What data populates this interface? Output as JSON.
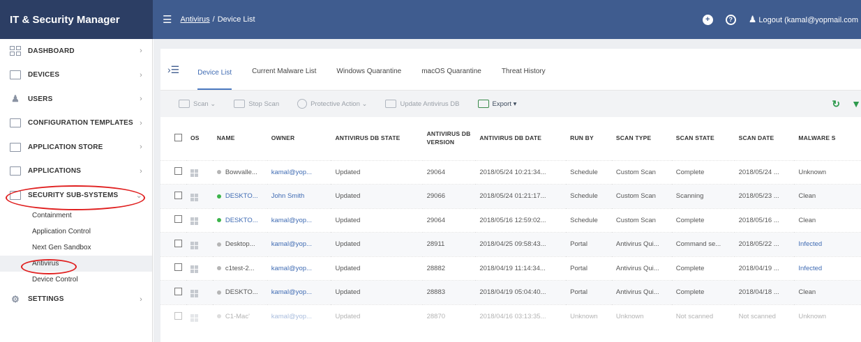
{
  "app": {
    "title": "IT & Security Manager"
  },
  "header": {
    "breadcrumb_link": "Antivirus",
    "breadcrumb_sep": "/",
    "breadcrumb_current": "Device List",
    "logout_label": "Logout (kamal@yopmail.com"
  },
  "sidebar": {
    "items": [
      {
        "label": "DASHBOARD",
        "icon": "dashboard-icon"
      },
      {
        "label": "DEVICES",
        "icon": "devices-icon"
      },
      {
        "label": "USERS",
        "icon": "user-icon"
      },
      {
        "label": "CONFIGURATION TEMPLATES",
        "icon": "templates-icon"
      },
      {
        "label": "APPLICATION STORE",
        "icon": "store-icon"
      },
      {
        "label": "APPLICATIONS",
        "icon": "applications-icon"
      },
      {
        "label": "SECURITY SUB-SYSTEMS",
        "icon": "security-icon"
      },
      {
        "label": "SETTINGS",
        "icon": "gear-icon"
      }
    ],
    "sub_items": [
      "Containment",
      "Application Control",
      "Next Gen Sandbox",
      "Antivirus",
      "Device Control"
    ]
  },
  "tabs": [
    "Device List",
    "Current Malware List",
    "Windows Quarantine",
    "macOS Quarantine",
    "Threat History"
  ],
  "toolbar": {
    "scan": "Scan",
    "stop_scan": "Stop Scan",
    "protective_action": "Protective Action",
    "update_db": "Update Antivirus DB",
    "export": "Export"
  },
  "table": {
    "headers": [
      "OS",
      "NAME",
      "OWNER",
      "ANTIVIRUS DB STATE",
      "ANTIVIRUS DB VERSION",
      "ANTIVIRUS DB DATE",
      "RUN BY",
      "SCAN TYPE",
      "SCAN STATE",
      "SCAN DATE",
      "MALWARE S"
    ],
    "rows": [
      {
        "status": "grey",
        "name": "Bowvalle...",
        "owner": "kamal@yop...",
        "db_state": "Updated",
        "db_version": "29064",
        "db_date": "2018/05/24 10:21:34...",
        "run_by": "Schedule",
        "scan_type": "Custom Scan",
        "scan_state": "Complete",
        "scan_date": "2018/05/24 ...",
        "malware": "Unknown"
      },
      {
        "status": "green",
        "name": "DESKTO...",
        "owner": "John Smith",
        "db_state": "Updated",
        "db_version": "29066",
        "db_date": "2018/05/24 01:21:17...",
        "run_by": "Schedule",
        "scan_type": "Custom Scan",
        "scan_state": "Scanning",
        "scan_date": "2018/05/23 ...",
        "malware": "Clean"
      },
      {
        "status": "green",
        "name": "DESKTO...",
        "owner": "kamal@yop...",
        "db_state": "Updated",
        "db_version": "29064",
        "db_date": "2018/05/16 12:59:02...",
        "run_by": "Schedule",
        "scan_type": "Custom Scan",
        "scan_state": "Complete",
        "scan_date": "2018/05/16 ...",
        "malware": "Clean"
      },
      {
        "status": "grey",
        "name": "Desktop...",
        "owner": "kamal@yop...",
        "db_state": "Updated",
        "db_version": "28911",
        "db_date": "2018/04/25 09:58:43...",
        "run_by": "Portal",
        "scan_type": "Antivirus Qui...",
        "scan_state": "Command se...",
        "scan_date": "2018/05/22 ...",
        "malware": "Infected"
      },
      {
        "status": "grey",
        "name": "c1test-2...",
        "owner": "kamal@yop...",
        "db_state": "Updated",
        "db_version": "28882",
        "db_date": "2018/04/19 11:14:34...",
        "run_by": "Portal",
        "scan_type": "Antivirus Qui...",
        "scan_state": "Complete",
        "scan_date": "2018/04/19 ...",
        "malware": "Infected"
      },
      {
        "status": "grey",
        "name": "DESKTO...",
        "owner": "kamal@yop...",
        "db_state": "Updated",
        "db_version": "28883",
        "db_date": "2018/04/19 05:04:40...",
        "run_by": "Portal",
        "scan_type": "Antivirus Qui...",
        "scan_state": "Complete",
        "scan_date": "2018/04/18 ...",
        "malware": "Clean"
      },
      {
        "status": "grey",
        "name": "C1-Mac'",
        "owner": "kamal@yop...",
        "db_state": "Updated",
        "db_version": "28870",
        "db_date": "2018/04/16 03:13:35...",
        "run_by": "Unknown",
        "scan_type": "Unknown",
        "scan_state": "Not scanned",
        "scan_date": "Not scanned",
        "malware": "Unknown"
      }
    ]
  },
  "colors": {
    "brand": "#2c3e64",
    "appbar": "#3f5c8f",
    "accent": "#3f6bb3",
    "online": "#3cb44b",
    "offline": "#b5b5b5",
    "annotation": "#e02020"
  }
}
